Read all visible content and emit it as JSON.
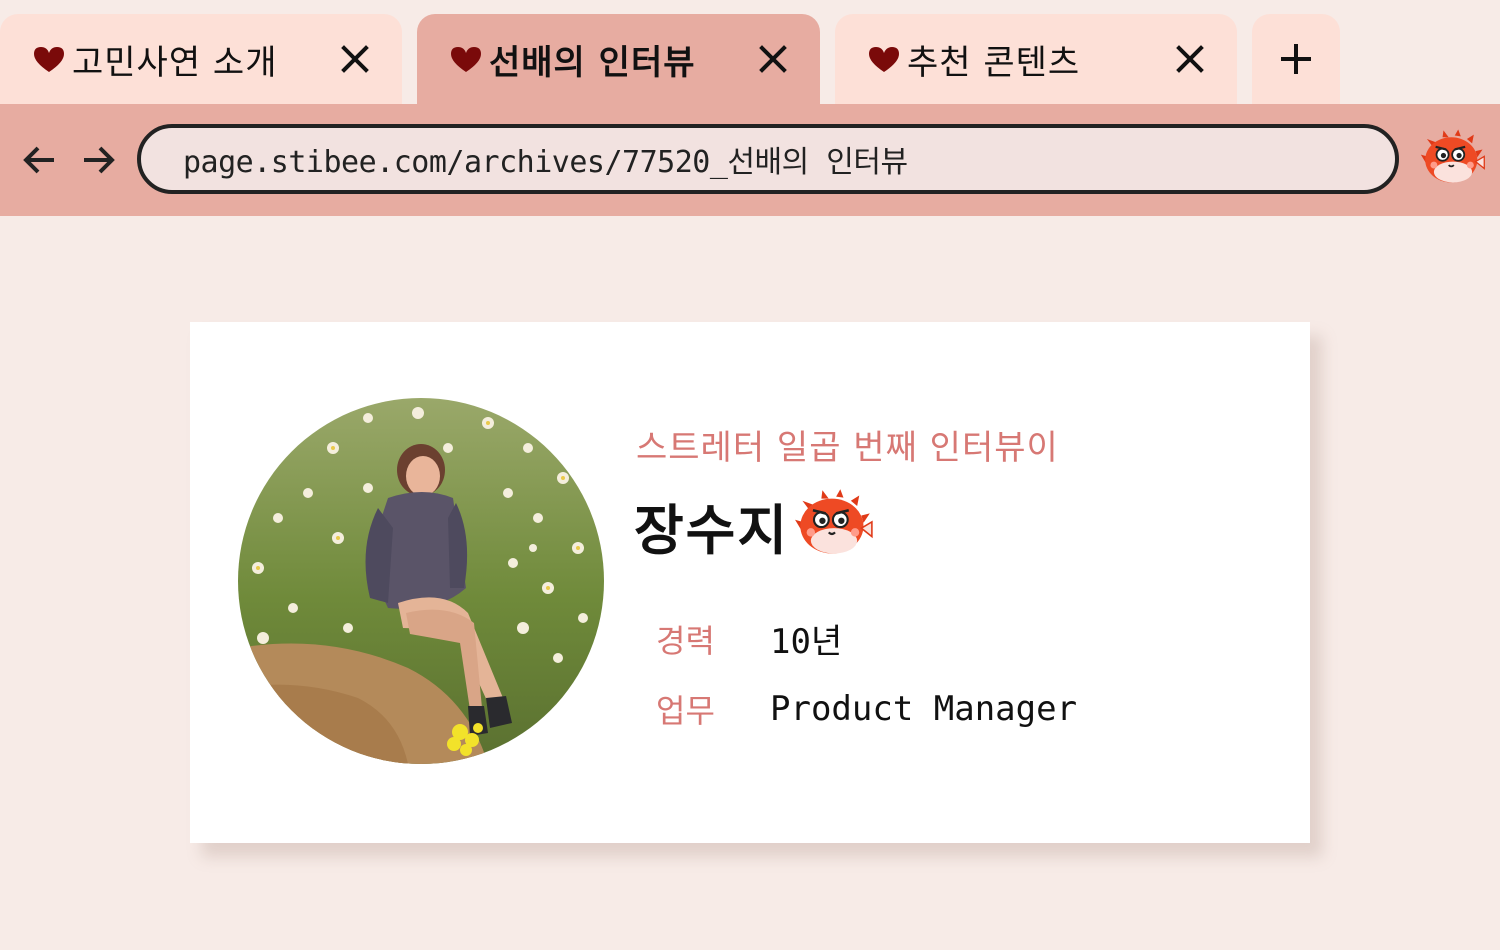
{
  "tabs": [
    {
      "label": "고민사연 소개",
      "active": false
    },
    {
      "label": "선배의 인터뷰",
      "active": true
    },
    {
      "label": "추천 콘텐츠",
      "active": false
    }
  ],
  "toolbar": {
    "url": "page.stibee.com/archives/77520_선배의 인터뷰"
  },
  "profile": {
    "subtitle": "스트레터 일곱 번째 인터뷰이",
    "name": "장수지",
    "career_label": "경력",
    "career_value": "10년",
    "role_label": "업무",
    "role_value": "Product Manager"
  },
  "icons": {
    "tab": "heart-icon",
    "close": "close-icon",
    "new_tab": "plus-icon",
    "back": "arrow-left-icon",
    "forward": "arrow-right-icon",
    "extension": "pufferfish-icon"
  },
  "colors": {
    "tab_inactive": "#fde0d7",
    "tab_active": "#e7aca1",
    "toolbar": "#e7aca1",
    "page_bg": "#f7ebe7",
    "accent_text": "#d77874",
    "heart": "#7a0a0a"
  }
}
